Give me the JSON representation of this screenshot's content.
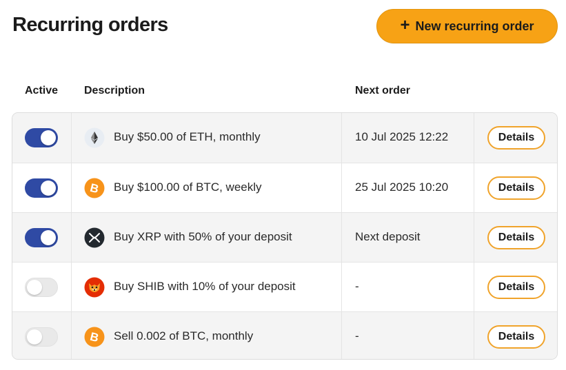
{
  "header": {
    "title": "Recurring orders",
    "new_order_label": "New recurring order",
    "new_order_icon": "+"
  },
  "columns": {
    "active": "Active",
    "description": "Description",
    "next_order": "Next order"
  },
  "colors": {
    "accent": "#f7a215",
    "toggle_on": "#2f4aa4",
    "details_border": "#f0a32a"
  },
  "orders": [
    {
      "active": true,
      "coin_icon": "eth-icon",
      "description": "Buy $50.00 of ETH, monthly",
      "next_order": "10 Jul 2025 12:22",
      "details_label": "Details"
    },
    {
      "active": true,
      "coin_icon": "btc-icon",
      "description": "Buy $100.00 of BTC, weekly",
      "next_order": "25 Jul 2025 10:20",
      "details_label": "Details"
    },
    {
      "active": true,
      "coin_icon": "xrp-icon",
      "description": "Buy XRP with 50% of your deposit",
      "next_order": "Next deposit",
      "details_label": "Details"
    },
    {
      "active": false,
      "coin_icon": "shib-icon",
      "description": "Buy SHIB with 10% of your deposit",
      "next_order": "-",
      "details_label": "Details"
    },
    {
      "active": false,
      "coin_icon": "btc-icon",
      "description": "Sell 0.002 of BTC, monthly",
      "next_order": "-",
      "details_label": "Details"
    }
  ]
}
